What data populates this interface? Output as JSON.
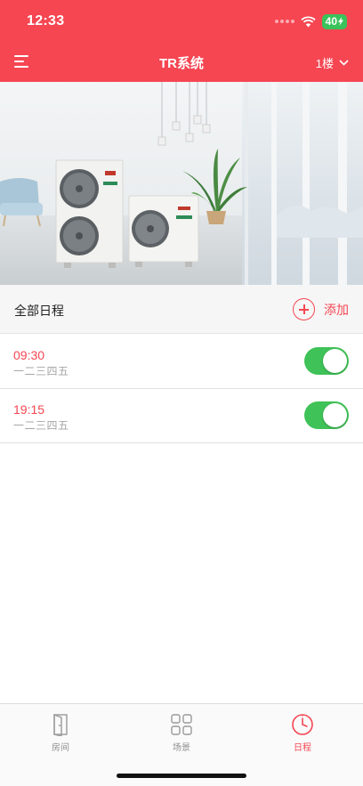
{
  "status": {
    "time": "12:33",
    "battery": "40"
  },
  "header": {
    "title": "TR系统",
    "floor": "1楼"
  },
  "section": {
    "title": "全部日程",
    "add_label": "添加"
  },
  "schedules": [
    {
      "time": "09:30",
      "days": "一二三四五",
      "enabled": true
    },
    {
      "time": "19:15",
      "days": "一二三四五",
      "enabled": true
    }
  ],
  "tabs": [
    {
      "label": "房间",
      "icon": "door-icon",
      "active": false
    },
    {
      "label": "场景",
      "icon": "grid-icon",
      "active": false
    },
    {
      "label": "日程",
      "icon": "clock-icon",
      "active": true
    }
  ],
  "colors": {
    "accent": "#f54652",
    "toggle_on": "#3fc257"
  }
}
